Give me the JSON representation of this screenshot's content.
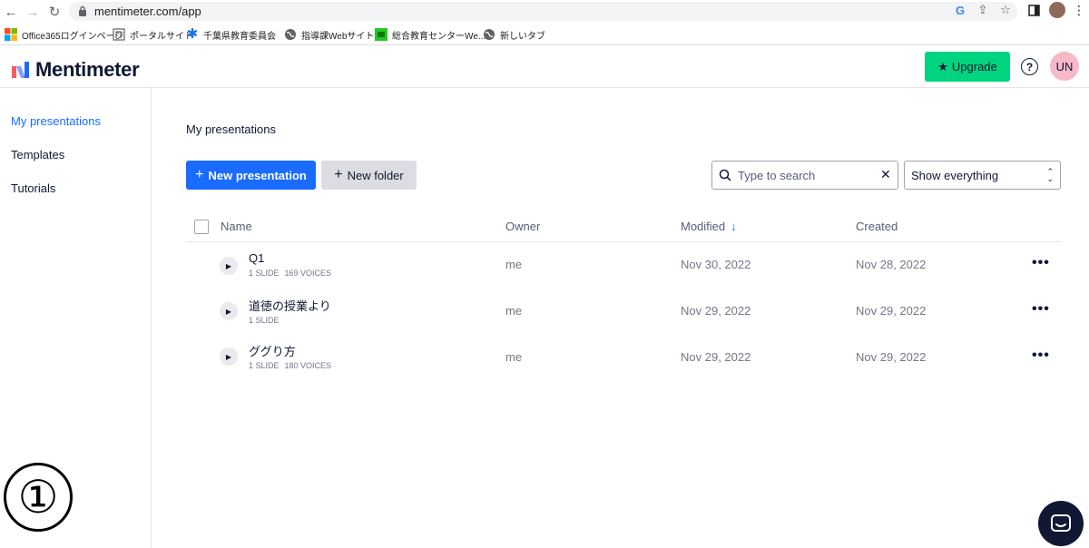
{
  "browser": {
    "url": "mentimeter.com/app",
    "bookmarks": [
      {
        "label": "Office365ログインページ",
        "icon": "microsoft-icon"
      },
      {
        "label": "ポータルサイト",
        "icon": "portal-icon"
      },
      {
        "label": "千葉県教育委員会",
        "icon": "asterisk-icon"
      },
      {
        "label": "指導課Webサイト",
        "icon": "globe-icon"
      },
      {
        "label": "総合教育センターWe...",
        "icon": "center-icon"
      },
      {
        "label": "新しいタブ",
        "icon": "globe-icon"
      }
    ]
  },
  "header": {
    "brand": "Mentimeter",
    "upgrade_label": "Upgrade",
    "help_label": "?",
    "avatar_initials": "UN"
  },
  "sidebar": {
    "items": [
      {
        "label": "My presentations",
        "active": true
      },
      {
        "label": "Templates",
        "active": false
      },
      {
        "label": "Tutorials",
        "active": false
      }
    ],
    "annotation": "①"
  },
  "main": {
    "title": "My presentations",
    "new_presentation_label": "New presentation",
    "new_folder_label": "New folder",
    "search_placeholder": "Type to search",
    "filter_value": "Show everything",
    "columns": {
      "name": "Name",
      "owner": "Owner",
      "modified": "Modified",
      "created": "Created"
    },
    "rows": [
      {
        "name": "Q1",
        "slides": "1 SLIDE",
        "voices": "169 VOICES",
        "owner": "me",
        "modified": "Nov 30, 2022",
        "created": "Nov 28, 2022"
      },
      {
        "name": "道徳の授業より",
        "slides": "1 SLIDE",
        "voices": "",
        "owner": "me",
        "modified": "Nov 29, 2022",
        "created": "Nov 29, 2022"
      },
      {
        "name": "ググり方",
        "slides": "1 SLIDE",
        "voices": "180 VOICES",
        "owner": "me",
        "modified": "Nov 29, 2022",
        "created": "Nov 29, 2022"
      }
    ]
  },
  "colors": {
    "accent": "#196cff",
    "upgrade": "#00d47e",
    "avatar": "#f7b8c8",
    "text": "#101834"
  }
}
